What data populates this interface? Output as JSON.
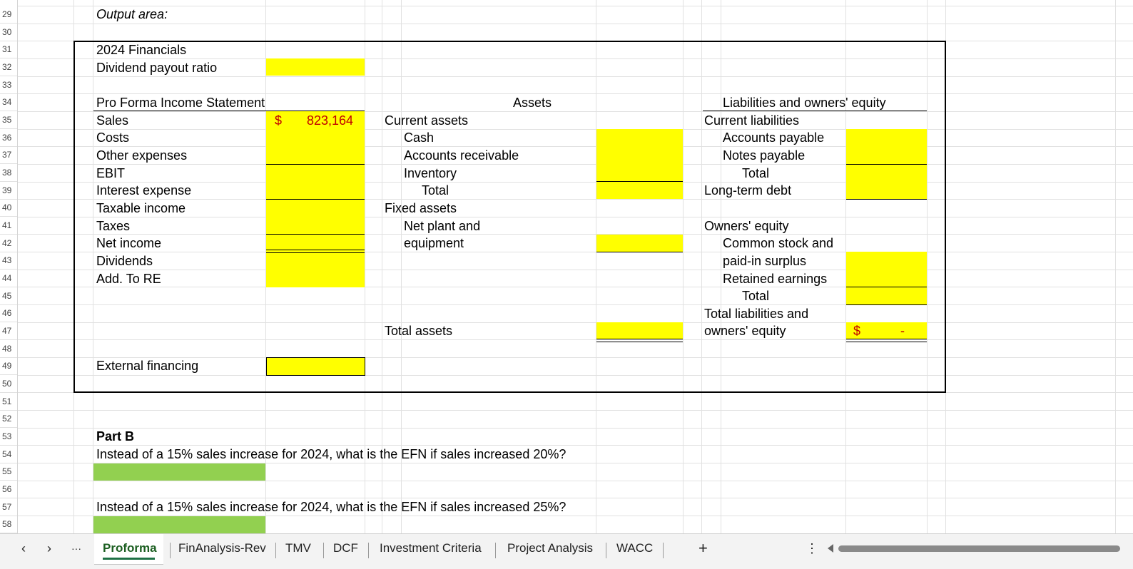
{
  "rows": [
    "29",
    "30",
    "31",
    "32",
    "33",
    "34",
    "35",
    "36",
    "37",
    "38",
    "39",
    "40",
    "41",
    "42",
    "43",
    "44",
    "45",
    "46",
    "47",
    "48",
    "49",
    "50",
    "51",
    "52",
    "53",
    "54",
    "55",
    "56",
    "57",
    "58"
  ],
  "output_area_label": "Output area:",
  "financials_title": "2024 Financials",
  "dividend_payout_label": "Dividend payout ratio",
  "income_statement": {
    "title": "Pro Forma Income Statement",
    "items": [
      "Sales",
      "Costs",
      "Other expenses",
      "EBIT",
      "Interest expense",
      "Taxable income",
      "Taxes",
      "Net income",
      "Dividends",
      "Add. To RE"
    ],
    "sales_currency": "$",
    "sales_value": "823,164"
  },
  "assets": {
    "header": "Assets",
    "current_assets": "Current assets",
    "cash": "Cash",
    "receivables": "Accounts receivable",
    "inventory": "Inventory",
    "total": "Total",
    "fixed_assets": "Fixed assets",
    "net_plant_1": "Net plant and",
    "net_plant_2": "equipment",
    "total_assets": "Total assets"
  },
  "liabilities": {
    "header": "Liabilities and owners' equity",
    "current_liabilities": "Current liabilities",
    "payable": "Accounts payable",
    "notes": "Notes payable",
    "total": "Total",
    "long_term_debt": "Long-term debt",
    "owners_equity": "Owners' equity",
    "common_stock_1": "Common stock and",
    "common_stock_2": "paid-in surplus",
    "retained": "Retained earnings",
    "total2": "Total",
    "tle_1": "Total liabilities and",
    "tle_2": "owners' equity",
    "tle_currency": "$",
    "tle_value": "-"
  },
  "external_financing_label": "External financing",
  "part_b": {
    "title": "Part B",
    "q1": "Instead of a 15% sales increase for 2024, what is the EFN if sales increased 20%?",
    "q2": "Instead of a 15% sales increase for 2024, what is the EFN if sales increased 25%?"
  },
  "tabs": {
    "proforma": "Proforma",
    "finanalysis": "FinAnalysis-Rev",
    "tmv": "TMV",
    "dcf": "DCF",
    "investment": "Investment Criteria",
    "project": "Project Analysis",
    "wacc": "WACC",
    "add": "+",
    "more": "⋮",
    "ellipsis": "···",
    "prev": "‹",
    "next": "›"
  },
  "colors": {
    "yellow": "#ffff00",
    "green": "#92d050",
    "red": "#c00000"
  }
}
